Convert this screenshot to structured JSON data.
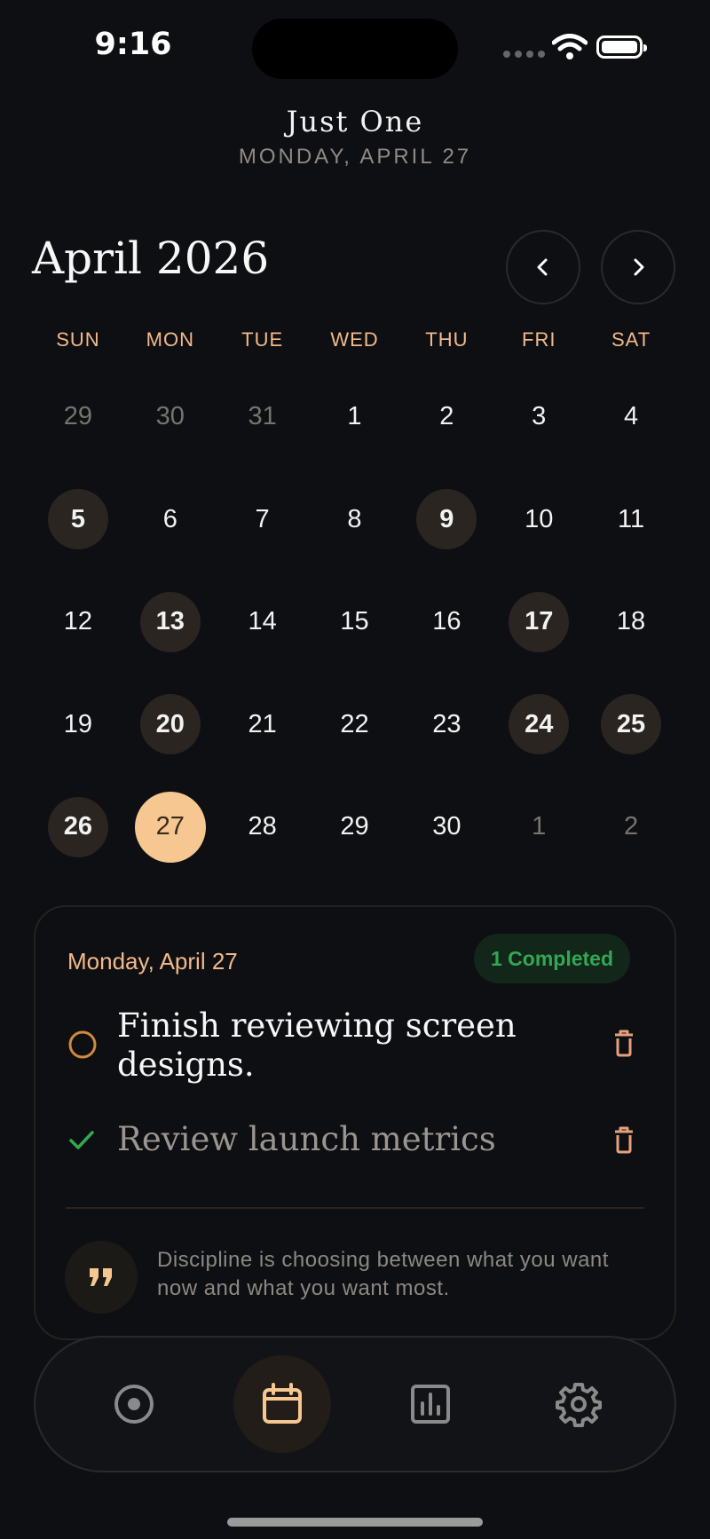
{
  "status_bar": {
    "time": "9:16"
  },
  "header": {
    "app_title": "Just One",
    "date": "MONDAY, APRIL 27"
  },
  "calendar": {
    "month_title": "April 2026",
    "weekdays": [
      "SUN",
      "MON",
      "TUE",
      "WED",
      "THU",
      "FRI",
      "SAT"
    ],
    "days": [
      {
        "n": "29",
        "out": true
      },
      {
        "n": "30",
        "out": true
      },
      {
        "n": "31",
        "out": true
      },
      {
        "n": "1"
      },
      {
        "n": "2"
      },
      {
        "n": "3"
      },
      {
        "n": "4"
      },
      {
        "n": "5",
        "marked": true
      },
      {
        "n": "6"
      },
      {
        "n": "7"
      },
      {
        "n": "8"
      },
      {
        "n": "9",
        "marked": true
      },
      {
        "n": "10"
      },
      {
        "n": "11"
      },
      {
        "n": "12"
      },
      {
        "n": "13",
        "marked": true
      },
      {
        "n": "14"
      },
      {
        "n": "15"
      },
      {
        "n": "16"
      },
      {
        "n": "17",
        "marked": true
      },
      {
        "n": "18"
      },
      {
        "n": "19"
      },
      {
        "n": "20",
        "marked": true
      },
      {
        "n": "21"
      },
      {
        "n": "22"
      },
      {
        "n": "23"
      },
      {
        "n": "24",
        "marked": true
      },
      {
        "n": "25",
        "marked": true
      },
      {
        "n": "26",
        "marked": true
      },
      {
        "n": "27",
        "selected": true
      },
      {
        "n": "28"
      },
      {
        "n": "29"
      },
      {
        "n": "30"
      },
      {
        "n": "1",
        "out": true
      },
      {
        "n": "2",
        "out": true
      }
    ]
  },
  "tasks": {
    "date_label": "Monday, April 27",
    "badge": "1 Completed",
    "items": [
      {
        "text": "Finish reviewing screen designs.",
        "done": false
      },
      {
        "text": "Review launch metrics",
        "done": true
      }
    ]
  },
  "quote": {
    "text": "Discipline is choosing between what you want now and what you want most."
  },
  "tabbar": {
    "tabs": [
      "focus-icon",
      "calendar-icon",
      "stats-icon",
      "settings-icon"
    ],
    "active": 1
  },
  "colors": {
    "accent": "#f6c791",
    "accent_text": "#f3b98a",
    "success": "#32a852",
    "background": "#0e0f12"
  }
}
